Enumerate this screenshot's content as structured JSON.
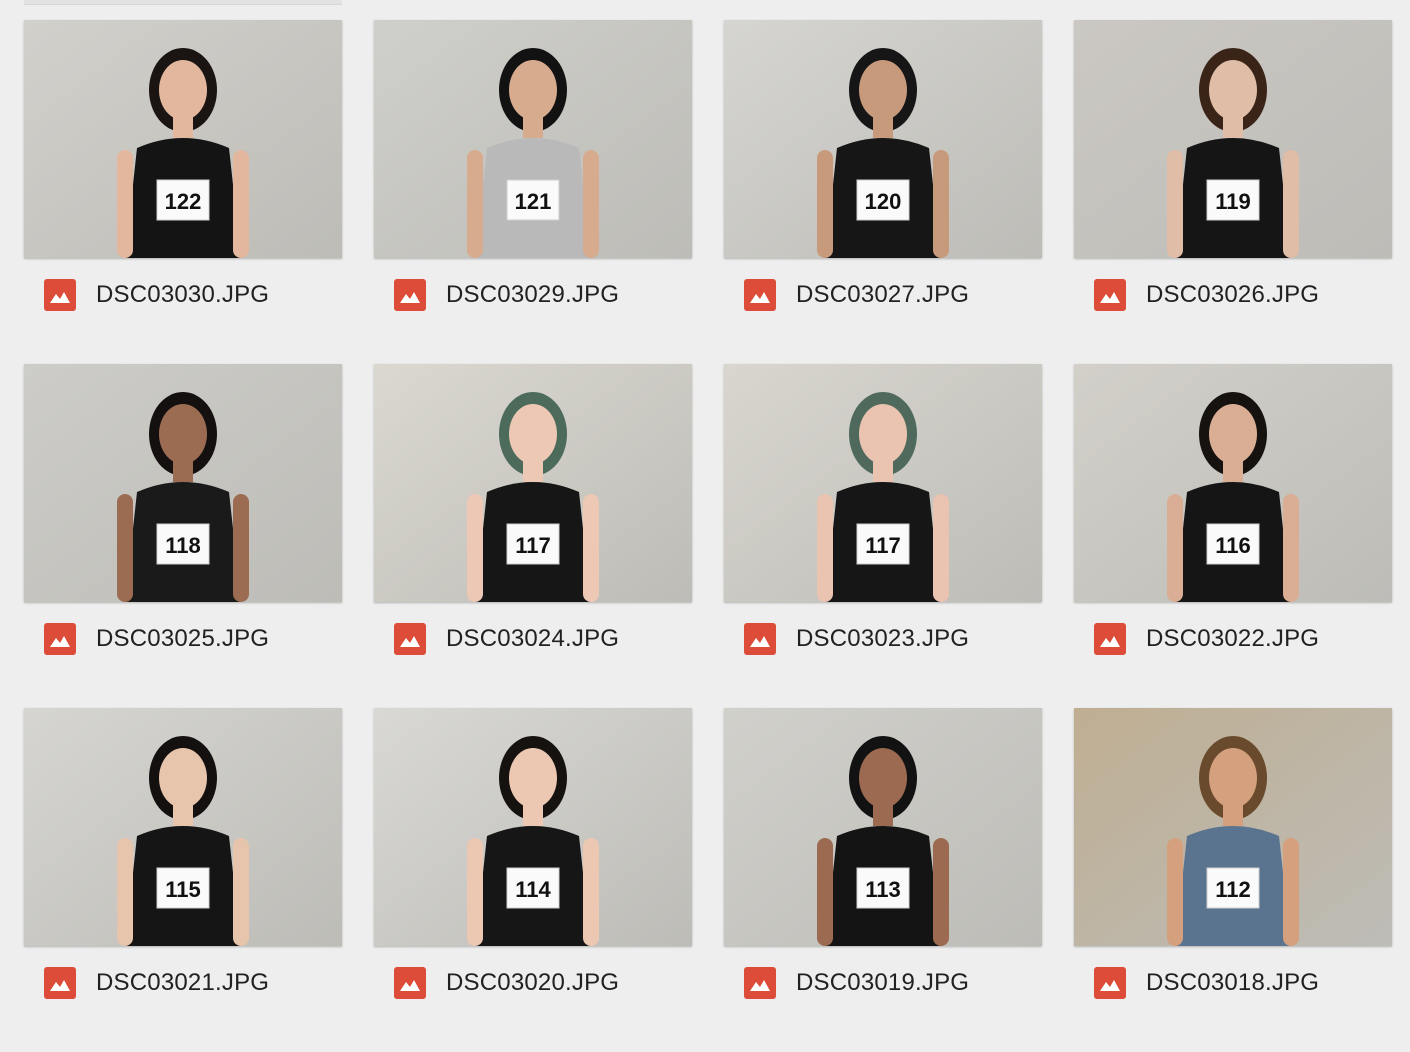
{
  "colors": {
    "image_icon": "#dd4b39",
    "background": "#eeeeee"
  },
  "files": [
    {
      "name": "DSC03030.JPG",
      "bib": "122",
      "wall": "#d2d0cb",
      "skin": "#e2b79e",
      "hair": "#1a1412",
      "top": "#141414"
    },
    {
      "name": "DSC03029.JPG",
      "bib": "121",
      "wall": "#cfcfcb",
      "skin": "#d6ab8e",
      "hair": "#121212",
      "top": "#b9b9b9"
    },
    {
      "name": "DSC03027.JPG",
      "bib": "120",
      "wall": "#d6d5d1",
      "skin": "#c79a7c",
      "hair": "#161616",
      "top": "#161616"
    },
    {
      "name": "DSC03026.JPG",
      "bib": "119",
      "wall": "#cbc8c3",
      "skin": "#e0bda6",
      "hair": "#3a2418",
      "top": "#151515"
    },
    {
      "name": "DSC03025.JPG",
      "bib": "118",
      "wall": "#cdccc8",
      "skin": "#9c6c52",
      "hair": "#141010",
      "top": "#1a1a1a"
    },
    {
      "name": "DSC03024.JPG",
      "bib": "117",
      "wall": "#dad8cf",
      "skin": "#edc8b4",
      "hair": "#4d6b5a",
      "top": "#161616"
    },
    {
      "name": "DSC03023.JPG",
      "bib": "117",
      "wall": "#d8d6ce",
      "skin": "#eac4b0",
      "hair": "#4f6a5c",
      "top": "#161616"
    },
    {
      "name": "DSC03022.JPG",
      "bib": "116",
      "wall": "#d2d0c9",
      "skin": "#d9ae94",
      "hair": "#161210",
      "top": "#151515"
    },
    {
      "name": "DSC03021.JPG",
      "bib": "115",
      "wall": "#d6d5d1",
      "skin": "#e7c4ac",
      "hair": "#141010",
      "top": "#151515"
    },
    {
      "name": "DSC03020.JPG",
      "bib": "114",
      "wall": "#d9d8d4",
      "skin": "#ecc8b2",
      "hair": "#161210",
      "top": "#161616"
    },
    {
      "name": "DSC03019.JPG",
      "bib": "113",
      "wall": "#d1d0cb",
      "skin": "#9c6a50",
      "hair": "#121212",
      "top": "#141414"
    },
    {
      "name": "DSC03018.JPG",
      "bib": "112",
      "wall": "#bfae92",
      "skin": "#d4a07e",
      "hair": "#6a4a2c",
      "top": "#5a7490"
    }
  ]
}
